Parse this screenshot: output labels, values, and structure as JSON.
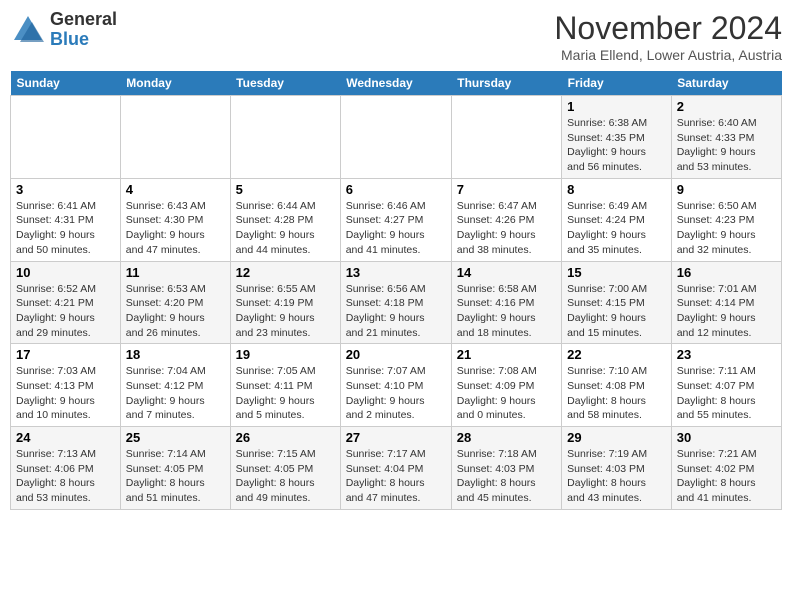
{
  "header": {
    "logo_line1": "General",
    "logo_line2": "Blue",
    "month": "November 2024",
    "location": "Maria Ellend, Lower Austria, Austria"
  },
  "weekdays": [
    "Sunday",
    "Monday",
    "Tuesday",
    "Wednesday",
    "Thursday",
    "Friday",
    "Saturday"
  ],
  "weeks": [
    [
      {
        "day": "",
        "info": ""
      },
      {
        "day": "",
        "info": ""
      },
      {
        "day": "",
        "info": ""
      },
      {
        "day": "",
        "info": ""
      },
      {
        "day": "",
        "info": ""
      },
      {
        "day": "1",
        "info": "Sunrise: 6:38 AM\nSunset: 4:35 PM\nDaylight: 9 hours\nand 56 minutes."
      },
      {
        "day": "2",
        "info": "Sunrise: 6:40 AM\nSunset: 4:33 PM\nDaylight: 9 hours\nand 53 minutes."
      }
    ],
    [
      {
        "day": "3",
        "info": "Sunrise: 6:41 AM\nSunset: 4:31 PM\nDaylight: 9 hours\nand 50 minutes."
      },
      {
        "day": "4",
        "info": "Sunrise: 6:43 AM\nSunset: 4:30 PM\nDaylight: 9 hours\nand 47 minutes."
      },
      {
        "day": "5",
        "info": "Sunrise: 6:44 AM\nSunset: 4:28 PM\nDaylight: 9 hours\nand 44 minutes."
      },
      {
        "day": "6",
        "info": "Sunrise: 6:46 AM\nSunset: 4:27 PM\nDaylight: 9 hours\nand 41 minutes."
      },
      {
        "day": "7",
        "info": "Sunrise: 6:47 AM\nSunset: 4:26 PM\nDaylight: 9 hours\nand 38 minutes."
      },
      {
        "day": "8",
        "info": "Sunrise: 6:49 AM\nSunset: 4:24 PM\nDaylight: 9 hours\nand 35 minutes."
      },
      {
        "day": "9",
        "info": "Sunrise: 6:50 AM\nSunset: 4:23 PM\nDaylight: 9 hours\nand 32 minutes."
      }
    ],
    [
      {
        "day": "10",
        "info": "Sunrise: 6:52 AM\nSunset: 4:21 PM\nDaylight: 9 hours\nand 29 minutes."
      },
      {
        "day": "11",
        "info": "Sunrise: 6:53 AM\nSunset: 4:20 PM\nDaylight: 9 hours\nand 26 minutes."
      },
      {
        "day": "12",
        "info": "Sunrise: 6:55 AM\nSunset: 4:19 PM\nDaylight: 9 hours\nand 23 minutes."
      },
      {
        "day": "13",
        "info": "Sunrise: 6:56 AM\nSunset: 4:18 PM\nDaylight: 9 hours\nand 21 minutes."
      },
      {
        "day": "14",
        "info": "Sunrise: 6:58 AM\nSunset: 4:16 PM\nDaylight: 9 hours\nand 18 minutes."
      },
      {
        "day": "15",
        "info": "Sunrise: 7:00 AM\nSunset: 4:15 PM\nDaylight: 9 hours\nand 15 minutes."
      },
      {
        "day": "16",
        "info": "Sunrise: 7:01 AM\nSunset: 4:14 PM\nDaylight: 9 hours\nand 12 minutes."
      }
    ],
    [
      {
        "day": "17",
        "info": "Sunrise: 7:03 AM\nSunset: 4:13 PM\nDaylight: 9 hours\nand 10 minutes."
      },
      {
        "day": "18",
        "info": "Sunrise: 7:04 AM\nSunset: 4:12 PM\nDaylight: 9 hours\nand 7 minutes."
      },
      {
        "day": "19",
        "info": "Sunrise: 7:05 AM\nSunset: 4:11 PM\nDaylight: 9 hours\nand 5 minutes."
      },
      {
        "day": "20",
        "info": "Sunrise: 7:07 AM\nSunset: 4:10 PM\nDaylight: 9 hours\nand 2 minutes."
      },
      {
        "day": "21",
        "info": "Sunrise: 7:08 AM\nSunset: 4:09 PM\nDaylight: 9 hours\nand 0 minutes."
      },
      {
        "day": "22",
        "info": "Sunrise: 7:10 AM\nSunset: 4:08 PM\nDaylight: 8 hours\nand 58 minutes."
      },
      {
        "day": "23",
        "info": "Sunrise: 7:11 AM\nSunset: 4:07 PM\nDaylight: 8 hours\nand 55 minutes."
      }
    ],
    [
      {
        "day": "24",
        "info": "Sunrise: 7:13 AM\nSunset: 4:06 PM\nDaylight: 8 hours\nand 53 minutes."
      },
      {
        "day": "25",
        "info": "Sunrise: 7:14 AM\nSunset: 4:05 PM\nDaylight: 8 hours\nand 51 minutes."
      },
      {
        "day": "26",
        "info": "Sunrise: 7:15 AM\nSunset: 4:05 PM\nDaylight: 8 hours\nand 49 minutes."
      },
      {
        "day": "27",
        "info": "Sunrise: 7:17 AM\nSunset: 4:04 PM\nDaylight: 8 hours\nand 47 minutes."
      },
      {
        "day": "28",
        "info": "Sunrise: 7:18 AM\nSunset: 4:03 PM\nDaylight: 8 hours\nand 45 minutes."
      },
      {
        "day": "29",
        "info": "Sunrise: 7:19 AM\nSunset: 4:03 PM\nDaylight: 8 hours\nand 43 minutes."
      },
      {
        "day": "30",
        "info": "Sunrise: 7:21 AM\nSunset: 4:02 PM\nDaylight: 8 hours\nand 41 minutes."
      }
    ]
  ]
}
